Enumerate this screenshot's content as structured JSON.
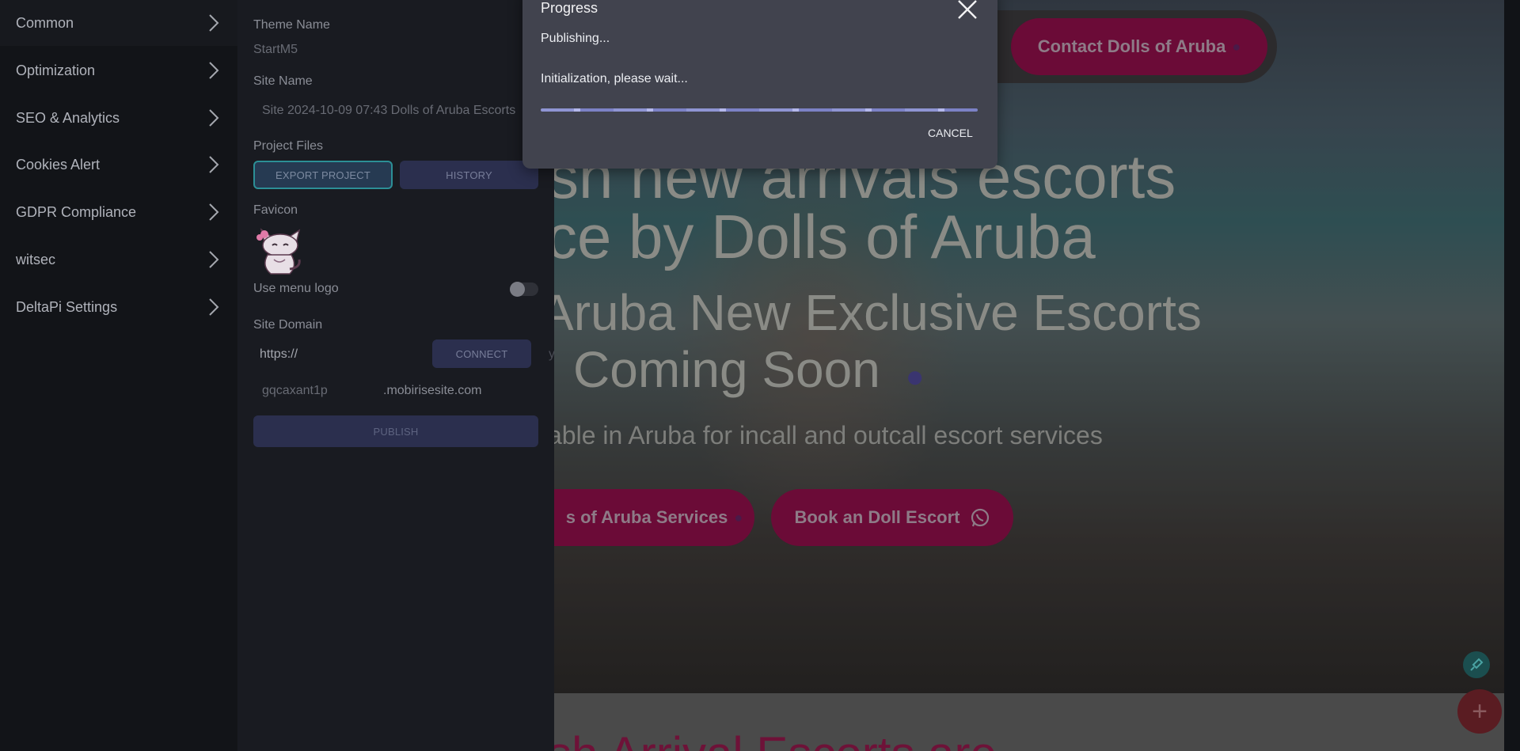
{
  "menu": {
    "items": [
      {
        "label": "Common"
      },
      {
        "label": "Optimization"
      },
      {
        "label": "SEO & Analytics"
      },
      {
        "label": "Cookies Alert"
      },
      {
        "label": "GDPR Compliance"
      },
      {
        "label": "witsec"
      },
      {
        "label": "DeltaPi Settings"
      }
    ]
  },
  "settings": {
    "theme_name_label": "Theme Name",
    "theme_name_value": "StartM5",
    "site_name_label": "Site Name",
    "site_name_value": "Site 2024-10-09 07:43 Dolls of Aruba Escorts",
    "project_files_label": "Project Files",
    "export_button": "EXPORT PROJECT",
    "history_button": "HISTORY",
    "favicon_label": "Favicon",
    "use_menu_logo_label": "Use menu logo",
    "use_menu_logo_on": false,
    "site_domain_label": "Site Domain",
    "domain_prefix": "https://",
    "domain_placeholder": "yourdomain.com",
    "connect_button": "CONNECT",
    "subdomain": "gqcaxant1p",
    "subdomain_suffix": ".mobirisesite.com",
    "publish_button": "PUBLISH"
  },
  "preview": {
    "contact_button": "Contact Dolls of Aruba",
    "title_line1": "sh new arrivals escorts",
    "title_line2": "ce by Dolls of Aruba",
    "title_line3": "Aruba New Exclusive Escorts",
    "title_line4": "Coming Soon",
    "subtitle": "able in Aruba for incall and outcall escort services",
    "services_button": "s of Aruba Services",
    "book_button": "Book an Doll Escort",
    "bottom_heading": "sh Arrival Escorts are"
  },
  "modal": {
    "title": "Progress",
    "status": "Publishing...",
    "message": "Initialization, please wait...",
    "cancel_button": "CANCEL"
  },
  "icons": {
    "chevron": "chevron-right-icon",
    "close": "close-icon",
    "paw": "paw-icon",
    "whatsapp": "whatsapp-icon",
    "edit": "brush-icon",
    "add": "plus-icon"
  },
  "colors": {
    "accent_pink": "#6b0b37",
    "progress_bar": "#8f95d3",
    "modal_bg": "#41434e",
    "panel_bg": "#191b21"
  }
}
